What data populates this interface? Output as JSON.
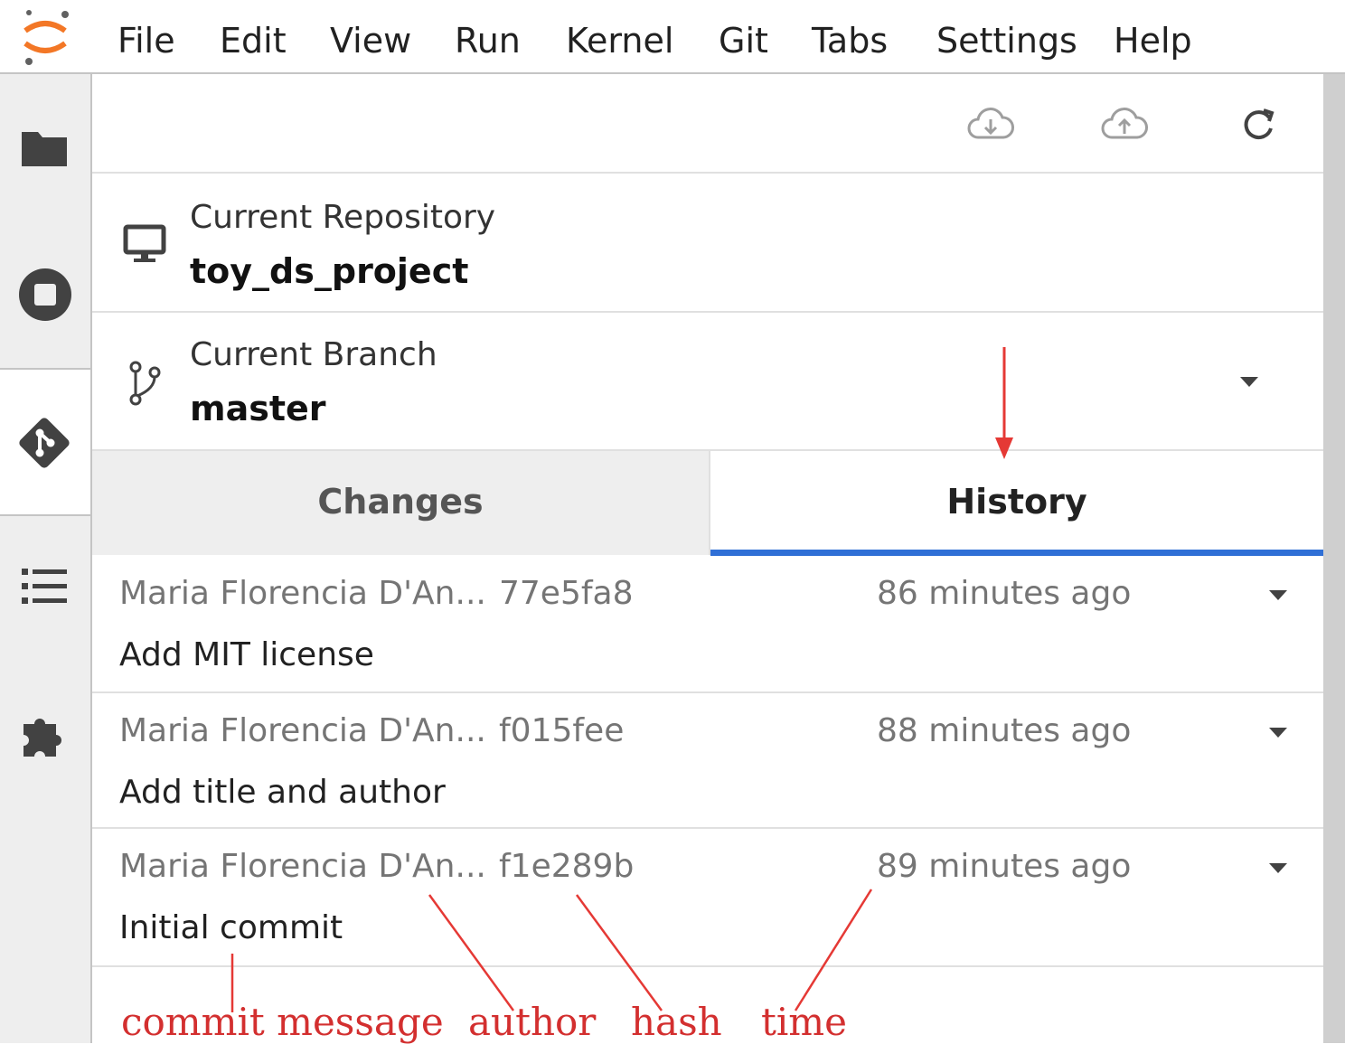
{
  "menu": {
    "items": [
      "File",
      "Edit",
      "View",
      "Run",
      "Kernel",
      "Git",
      "Tabs",
      "Settings",
      "Help"
    ]
  },
  "left_sidebar": {
    "icons": [
      "folder-icon",
      "running-icon",
      "git-icon",
      "toc-icon",
      "extension-icon"
    ],
    "active": "git-icon"
  },
  "toolbar": {
    "icons": [
      "cloud-download-icon",
      "cloud-upload-icon",
      "refresh-icon"
    ]
  },
  "repository": {
    "label": "Current Repository",
    "name": "toy_ds_project"
  },
  "branch": {
    "label": "Current Branch",
    "name": "master"
  },
  "tabs": {
    "changes": "Changes",
    "history": "History",
    "active": "History"
  },
  "commits": [
    {
      "author": "Maria Florencia D'An...",
      "hash": "77e5fa8",
      "time": "86 minutes ago",
      "message": "Add MIT license"
    },
    {
      "author": "Maria Florencia D'An...",
      "hash": "f015fee",
      "time": "88 minutes ago",
      "message": "Add title and author"
    },
    {
      "author": "Maria Florencia D'An...",
      "hash": "f1e289b",
      "time": "89 minutes ago",
      "message": "Initial commit"
    }
  ],
  "annotations": {
    "commit_message": "commit message",
    "author": "author",
    "hash": "hash",
    "time": "time"
  },
  "colors": {
    "accent": "#2f6fd6",
    "annotation": "#d32f2f",
    "logo": "#f37726"
  }
}
